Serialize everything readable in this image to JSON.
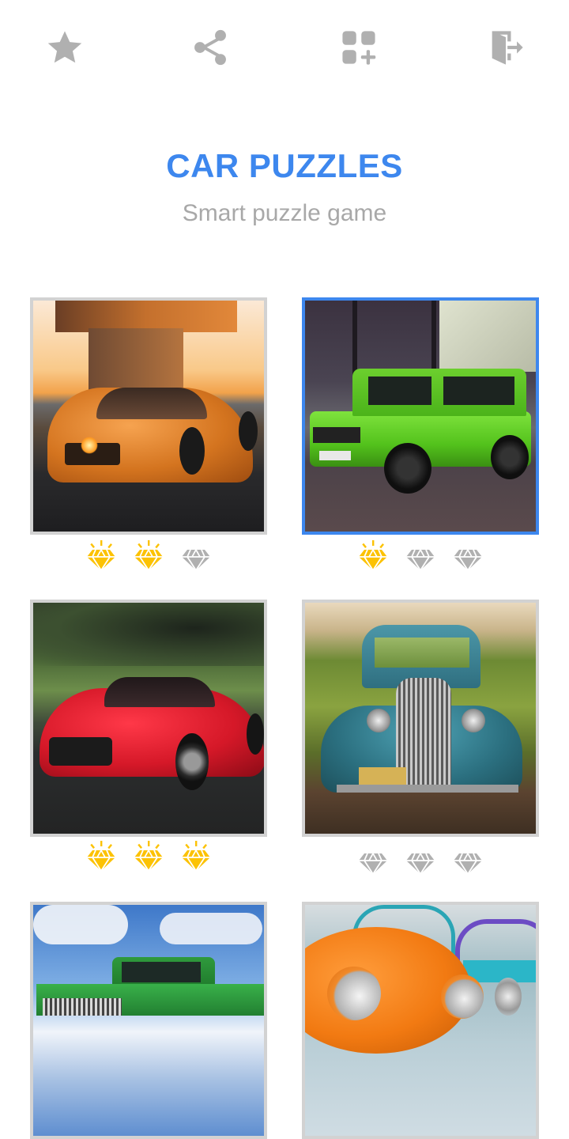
{
  "toolbar": {
    "items": [
      {
        "name": "favorite",
        "icon": "star-icon"
      },
      {
        "name": "share",
        "icon": "share-icon"
      },
      {
        "name": "more-apps",
        "icon": "apps-add-icon"
      },
      {
        "name": "exit",
        "icon": "exit-door-icon"
      }
    ]
  },
  "header": {
    "title": "CAR PUZZLES",
    "subtitle": "Smart puzzle game"
  },
  "colors": {
    "accent": "#3d87ee",
    "gem_earned": "#fcc203",
    "gem_empty": "#b0b0b0",
    "icon": "#b0b0b0"
  },
  "puzzles": [
    {
      "id": "orange-coupe",
      "description": "Orange sports coupe at sunset under a pier",
      "gems_earned": 2,
      "gems_total": 3,
      "selected": false
    },
    {
      "id": "green-suv",
      "description": "Green off-road SUV in front of glass building",
      "gems_earned": 1,
      "gems_total": 3,
      "selected": true
    },
    {
      "id": "red-coupe",
      "description": "Red sports coupe on a forest road",
      "gems_earned": 3,
      "gems_total": 3,
      "selected": false
    },
    {
      "id": "vintage-truck",
      "description": "Vintage teal pickup truck in a vineyard",
      "gems_earned": 0,
      "gems_total": 3,
      "selected": false
    },
    {
      "id": "green-pickup",
      "description": "Green classic pickup under blue sky",
      "gems_earned": null,
      "gems_total": 3,
      "selected": false
    },
    {
      "id": "vintage-beetles",
      "description": "Row of colorful vintage cars, orange in front",
      "gems_earned": null,
      "gems_total": 3,
      "selected": false
    }
  ]
}
